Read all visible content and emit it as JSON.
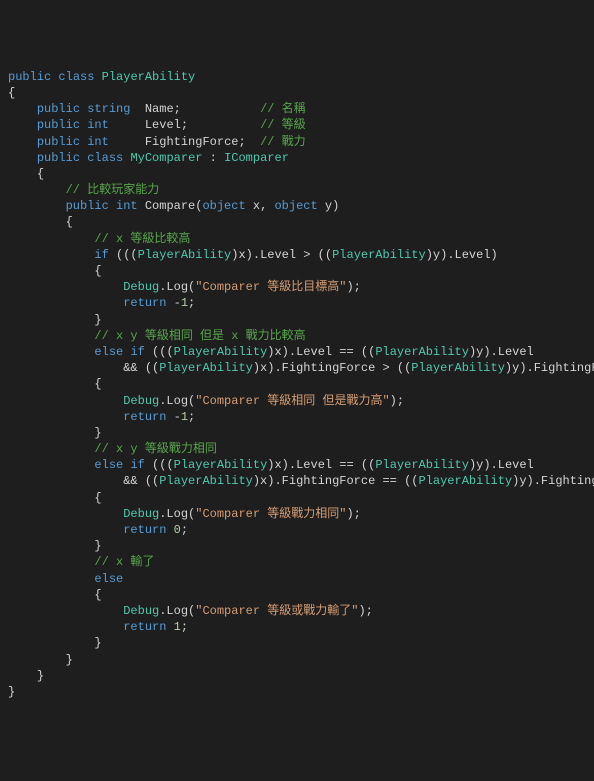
{
  "lines": [
    {
      "segments": [
        {
          "cls": "kw",
          "t": "public"
        },
        {
          "cls": "pln",
          "t": " "
        },
        {
          "cls": "kw",
          "t": "class"
        },
        {
          "cls": "pln",
          "t": " "
        },
        {
          "cls": "cls",
          "t": "PlayerAbility"
        }
      ]
    },
    {
      "segments": [
        {
          "cls": "br",
          "t": "{"
        }
      ]
    },
    {
      "segments": [
        {
          "cls": "pln",
          "t": "    "
        },
        {
          "cls": "kw",
          "t": "public"
        },
        {
          "cls": "pln",
          "t": " "
        },
        {
          "cls": "kw",
          "t": "string"
        },
        {
          "cls": "pln",
          "t": "  Name;           "
        },
        {
          "cls": "cmt",
          "t": "// 名稱"
        }
      ]
    },
    {
      "segments": [
        {
          "cls": "pln",
          "t": "    "
        },
        {
          "cls": "kw",
          "t": "public"
        },
        {
          "cls": "pln",
          "t": " "
        },
        {
          "cls": "kw",
          "t": "int"
        },
        {
          "cls": "pln",
          "t": "     Level;          "
        },
        {
          "cls": "cmt",
          "t": "// 等級"
        }
      ]
    },
    {
      "segments": [
        {
          "cls": "pln",
          "t": "    "
        },
        {
          "cls": "kw",
          "t": "public"
        },
        {
          "cls": "pln",
          "t": " "
        },
        {
          "cls": "kw",
          "t": "int"
        },
        {
          "cls": "pln",
          "t": "     FightingForce;  "
        },
        {
          "cls": "cmt",
          "t": "// 戰力"
        }
      ]
    },
    {
      "segments": [
        {
          "cls": "pln",
          "t": ""
        }
      ]
    },
    {
      "segments": [
        {
          "cls": "pln",
          "t": "    "
        },
        {
          "cls": "kw",
          "t": "public"
        },
        {
          "cls": "pln",
          "t": " "
        },
        {
          "cls": "kw",
          "t": "class"
        },
        {
          "cls": "pln",
          "t": " "
        },
        {
          "cls": "cls",
          "t": "MyComparer"
        },
        {
          "cls": "pln",
          "t": " : "
        },
        {
          "cls": "cls",
          "t": "IComparer"
        }
      ]
    },
    {
      "segments": [
        {
          "cls": "pln",
          "t": "    "
        },
        {
          "cls": "br",
          "t": "{"
        }
      ]
    },
    {
      "segments": [
        {
          "cls": "pln",
          "t": "        "
        },
        {
          "cls": "cmt",
          "t": "// 比較玩家能力"
        }
      ]
    },
    {
      "segments": [
        {
          "cls": "pln",
          "t": "        "
        },
        {
          "cls": "kw",
          "t": "public"
        },
        {
          "cls": "pln",
          "t": " "
        },
        {
          "cls": "kw",
          "t": "int"
        },
        {
          "cls": "pln",
          "t": " Compare("
        },
        {
          "cls": "kw",
          "t": "object"
        },
        {
          "cls": "pln",
          "t": " x, "
        },
        {
          "cls": "kw",
          "t": "object"
        },
        {
          "cls": "pln",
          "t": " y)"
        }
      ]
    },
    {
      "segments": [
        {
          "cls": "pln",
          "t": "        "
        },
        {
          "cls": "br",
          "t": "{"
        }
      ]
    },
    {
      "segments": [
        {
          "cls": "pln",
          "t": "            "
        },
        {
          "cls": "cmt",
          "t": "// x 等級比較高"
        }
      ]
    },
    {
      "segments": [
        {
          "cls": "pln",
          "t": "            "
        },
        {
          "cls": "kw",
          "t": "if"
        },
        {
          "cls": "pln",
          "t": " ((("
        },
        {
          "cls": "cls",
          "t": "PlayerAbility"
        },
        {
          "cls": "pln",
          "t": ")x).Level > (("
        },
        {
          "cls": "cls",
          "t": "PlayerAbility"
        },
        {
          "cls": "pln",
          "t": ")y).Level)"
        }
      ]
    },
    {
      "segments": [
        {
          "cls": "pln",
          "t": "            "
        },
        {
          "cls": "br",
          "t": "{"
        }
      ]
    },
    {
      "segments": [
        {
          "cls": "pln",
          "t": "                "
        },
        {
          "cls": "cls",
          "t": "Debug"
        },
        {
          "cls": "pln",
          "t": ".Log("
        },
        {
          "cls": "str",
          "t": "\"Comparer 等級比目標高\""
        },
        {
          "cls": "pln",
          "t": ");"
        }
      ]
    },
    {
      "segments": [
        {
          "cls": "pln",
          "t": "                "
        },
        {
          "cls": "kw",
          "t": "return"
        },
        {
          "cls": "pln",
          "t": " -"
        },
        {
          "cls": "num",
          "t": "1"
        },
        {
          "cls": "pln",
          "t": ";"
        }
      ]
    },
    {
      "segments": [
        {
          "cls": "pln",
          "t": "            "
        },
        {
          "cls": "br",
          "t": "}"
        }
      ]
    },
    {
      "segments": [
        {
          "cls": "pln",
          "t": "            "
        },
        {
          "cls": "cmt",
          "t": "// x y 等級相同 但是 x 戰力比較高"
        }
      ]
    },
    {
      "segments": [
        {
          "cls": "pln",
          "t": "            "
        },
        {
          "cls": "kw",
          "t": "else"
        },
        {
          "cls": "pln",
          "t": " "
        },
        {
          "cls": "kw",
          "t": "if"
        },
        {
          "cls": "pln",
          "t": " ((("
        },
        {
          "cls": "cls",
          "t": "PlayerAbility"
        },
        {
          "cls": "pln",
          "t": ")x).Level == (("
        },
        {
          "cls": "cls",
          "t": "PlayerAbility"
        },
        {
          "cls": "pln",
          "t": ")y).Level"
        }
      ]
    },
    {
      "segments": [
        {
          "cls": "pln",
          "t": "                && (("
        },
        {
          "cls": "cls",
          "t": "PlayerAbility"
        },
        {
          "cls": "pln",
          "t": ")x).FightingForce > (("
        },
        {
          "cls": "cls",
          "t": "PlayerAbility"
        },
        {
          "cls": "pln",
          "t": ")y).FightingForce)"
        }
      ]
    },
    {
      "segments": [
        {
          "cls": "pln",
          "t": "            "
        },
        {
          "cls": "br",
          "t": "{"
        }
      ]
    },
    {
      "segments": [
        {
          "cls": "pln",
          "t": "                "
        },
        {
          "cls": "cls",
          "t": "Debug"
        },
        {
          "cls": "pln",
          "t": ".Log("
        },
        {
          "cls": "str",
          "t": "\"Comparer 等級相同 但是戰力高\""
        },
        {
          "cls": "pln",
          "t": ");"
        }
      ]
    },
    {
      "segments": [
        {
          "cls": "pln",
          "t": "                "
        },
        {
          "cls": "kw",
          "t": "return"
        },
        {
          "cls": "pln",
          "t": " -"
        },
        {
          "cls": "num",
          "t": "1"
        },
        {
          "cls": "pln",
          "t": ";"
        }
      ]
    },
    {
      "segments": [
        {
          "cls": "pln",
          "t": "            "
        },
        {
          "cls": "br",
          "t": "}"
        }
      ]
    },
    {
      "segments": [
        {
          "cls": "pln",
          "t": "            "
        },
        {
          "cls": "cmt",
          "t": "// x y 等級戰力相同"
        }
      ]
    },
    {
      "segments": [
        {
          "cls": "pln",
          "t": "            "
        },
        {
          "cls": "kw",
          "t": "else"
        },
        {
          "cls": "pln",
          "t": " "
        },
        {
          "cls": "kw",
          "t": "if"
        },
        {
          "cls": "pln",
          "t": " ((("
        },
        {
          "cls": "cls",
          "t": "PlayerAbility"
        },
        {
          "cls": "pln",
          "t": ")x).Level == (("
        },
        {
          "cls": "cls",
          "t": "PlayerAbility"
        },
        {
          "cls": "pln",
          "t": ")y).Level"
        }
      ]
    },
    {
      "segments": [
        {
          "cls": "pln",
          "t": "                && (("
        },
        {
          "cls": "cls",
          "t": "PlayerAbility"
        },
        {
          "cls": "pln",
          "t": ")x).FightingForce == (("
        },
        {
          "cls": "cls",
          "t": "PlayerAbility"
        },
        {
          "cls": "pln",
          "t": ")y).FightingForce)"
        }
      ]
    },
    {
      "segments": [
        {
          "cls": "pln",
          "t": "            "
        },
        {
          "cls": "br",
          "t": "{"
        }
      ]
    },
    {
      "segments": [
        {
          "cls": "pln",
          "t": "                "
        },
        {
          "cls": "cls",
          "t": "Debug"
        },
        {
          "cls": "pln",
          "t": ".Log("
        },
        {
          "cls": "str",
          "t": "\"Comparer 等級戰力相同\""
        },
        {
          "cls": "pln",
          "t": ");"
        }
      ]
    },
    {
      "segments": [
        {
          "cls": "pln",
          "t": "                "
        },
        {
          "cls": "kw",
          "t": "return"
        },
        {
          "cls": "pln",
          "t": " "
        },
        {
          "cls": "num",
          "t": "0"
        },
        {
          "cls": "pln",
          "t": ";"
        }
      ]
    },
    {
      "segments": [
        {
          "cls": "pln",
          "t": "            "
        },
        {
          "cls": "br",
          "t": "}"
        }
      ]
    },
    {
      "segments": [
        {
          "cls": "pln",
          "t": "            "
        },
        {
          "cls": "cmt",
          "t": "// x 輸了"
        }
      ]
    },
    {
      "segments": [
        {
          "cls": "pln",
          "t": "            "
        },
        {
          "cls": "kw",
          "t": "else"
        }
      ]
    },
    {
      "segments": [
        {
          "cls": "pln",
          "t": "            "
        },
        {
          "cls": "br",
          "t": "{"
        }
      ]
    },
    {
      "segments": [
        {
          "cls": "pln",
          "t": "                "
        },
        {
          "cls": "cls",
          "t": "Debug"
        },
        {
          "cls": "pln",
          "t": ".Log("
        },
        {
          "cls": "str",
          "t": "\"Comparer 等級或戰力輸了\""
        },
        {
          "cls": "pln",
          "t": ");"
        }
      ]
    },
    {
      "segments": [
        {
          "cls": "pln",
          "t": "                "
        },
        {
          "cls": "kw",
          "t": "return"
        },
        {
          "cls": "pln",
          "t": " "
        },
        {
          "cls": "num",
          "t": "1"
        },
        {
          "cls": "pln",
          "t": ";"
        }
      ]
    },
    {
      "segments": [
        {
          "cls": "pln",
          "t": "            "
        },
        {
          "cls": "br",
          "t": "}"
        }
      ]
    },
    {
      "segments": [
        {
          "cls": "pln",
          "t": "        "
        },
        {
          "cls": "br",
          "t": "}"
        }
      ]
    },
    {
      "segments": [
        {
          "cls": "pln",
          "t": "    "
        },
        {
          "cls": "br",
          "t": "}"
        }
      ]
    },
    {
      "segments": [
        {
          "cls": "br",
          "t": "}"
        }
      ]
    }
  ]
}
